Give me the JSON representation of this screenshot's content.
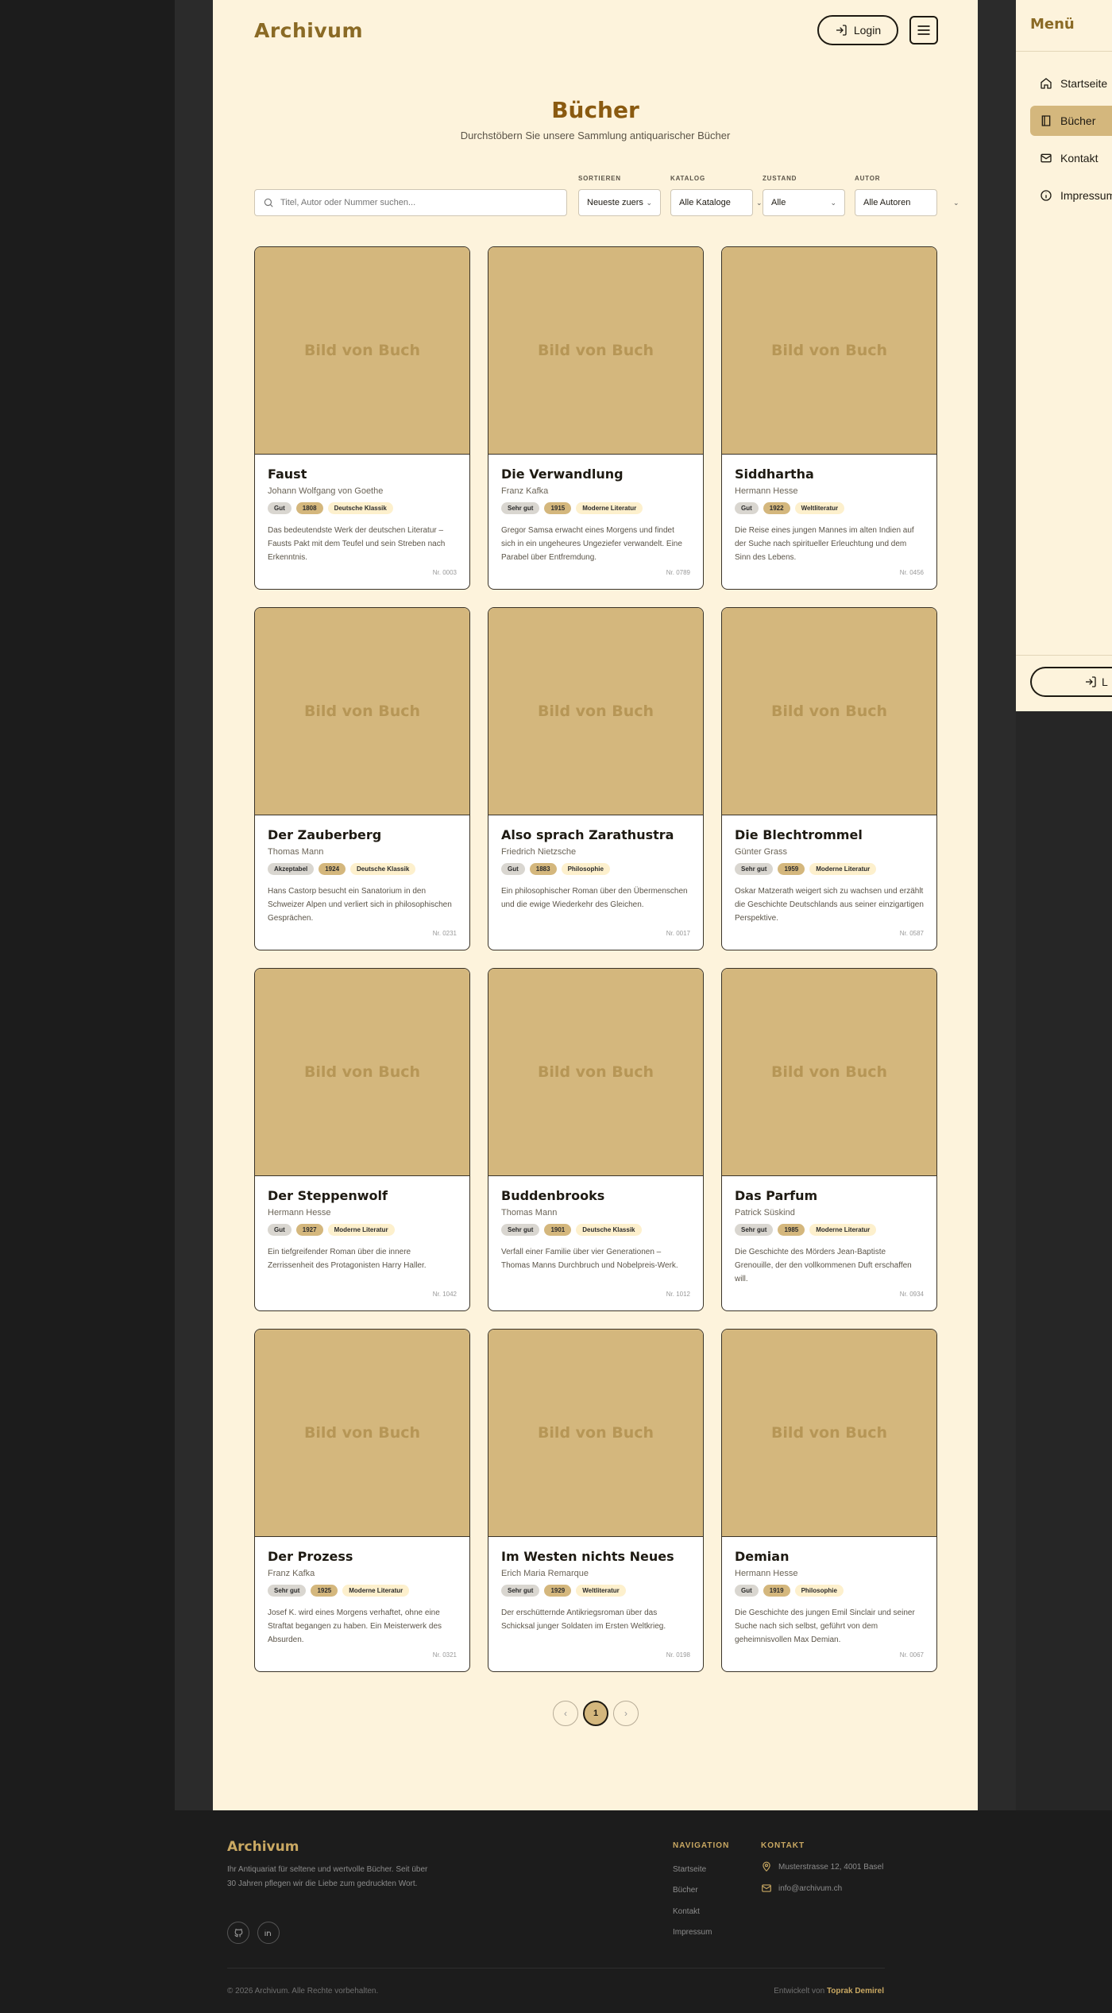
{
  "header": {
    "logo": "Archivum",
    "login_label": "Login"
  },
  "page": {
    "title": "Bücher",
    "subtitle": "Durchstöbern Sie unsere Sammlung antiquarischer Bücher"
  },
  "filters": {
    "search_placeholder": "Titel, Autor oder Nummer suchen...",
    "sort": {
      "label": "SORTIEREN",
      "value": "Neueste zuers"
    },
    "catalog": {
      "label": "KATALOG",
      "value": "Alle Kataloge"
    },
    "condition": {
      "label": "ZUSTAND",
      "value": "Alle"
    },
    "author": {
      "label": "AUTOR",
      "value": "Alle Autoren"
    }
  },
  "image_placeholder": "Bild von Buch",
  "books": [
    {
      "title": "Faust",
      "author": "Johann Wolfgang von Goethe",
      "condition": "Gut",
      "year": "1808",
      "category": "Deutsche Klassik",
      "description": "Das bedeutendste Werk der deutschen Literatur – Fausts Pakt mit dem Teufel und sein Streben nach Erkenntnis.",
      "nr": "Nr. 0003"
    },
    {
      "title": "Die Verwandlung",
      "author": "Franz Kafka",
      "condition": "Sehr gut",
      "year": "1915",
      "category": "Moderne Literatur",
      "description": "Gregor Samsa erwacht eines Morgens und findet sich in ein ungeheures Ungeziefer verwandelt. Eine Parabel über Entfremdung.",
      "nr": "Nr. 0789"
    },
    {
      "title": "Siddhartha",
      "author": "Hermann Hesse",
      "condition": "Gut",
      "year": "1922",
      "category": "Weltliteratur",
      "description": "Die Reise eines jungen Mannes im alten Indien auf der Suche nach spiritueller Erleuchtung und dem Sinn des Lebens.",
      "nr": "Nr. 0456"
    },
    {
      "title": "Der Zauberberg",
      "author": "Thomas Mann",
      "condition": "Akzeptabel",
      "year": "1924",
      "category": "Deutsche Klassik",
      "description": "Hans Castorp besucht ein Sanatorium in den Schweizer Alpen und verliert sich in philosophischen Gesprächen.",
      "nr": "Nr. 0231"
    },
    {
      "title": "Also sprach Zarathustra",
      "author": "Friedrich Nietzsche",
      "condition": "Gut",
      "year": "1883",
      "category": "Philosophie",
      "description": "Ein philosophischer Roman über den Übermenschen und die ewige Wiederkehr des Gleichen.",
      "nr": "Nr. 0017"
    },
    {
      "title": "Die Blechtrommel",
      "author": "Günter Grass",
      "condition": "Sehr gut",
      "year": "1959",
      "category": "Moderne Literatur",
      "description": "Oskar Matzerath weigert sich zu wachsen und erzählt die Geschichte Deutschlands aus seiner einzigartigen Perspektive.",
      "nr": "Nr. 0587"
    },
    {
      "title": "Der Steppenwolf",
      "author": "Hermann Hesse",
      "condition": "Gut",
      "year": "1927",
      "category": "Moderne Literatur",
      "description": "Ein tiefgreifender Roman über die innere Zerrissenheit des Protagonisten Harry Haller.",
      "nr": "Nr. 1042"
    },
    {
      "title": "Buddenbrooks",
      "author": "Thomas Mann",
      "condition": "Sehr gut",
      "year": "1901",
      "category": "Deutsche Klassik",
      "description": "Verfall einer Familie über vier Generationen – Thomas Manns Durchbruch und Nobelpreis-Werk.",
      "nr": "Nr. 1012"
    },
    {
      "title": "Das Parfum",
      "author": "Patrick Süskind",
      "condition": "Sehr gut",
      "year": "1985",
      "category": "Moderne Literatur",
      "description": "Die Geschichte des Mörders Jean-Baptiste Grenouille, der den vollkommenen Duft erschaffen will.",
      "nr": "Nr. 0934"
    },
    {
      "title": "Der Prozess",
      "author": "Franz Kafka",
      "condition": "Sehr gut",
      "year": "1925",
      "category": "Moderne Literatur",
      "description": "Josef K. wird eines Morgens verhaftet, ohne eine Straftat begangen zu haben. Ein Meisterwerk des Absurden.",
      "nr": "Nr. 0321"
    },
    {
      "title": "Im Westen nichts Neues",
      "author": "Erich Maria Remarque",
      "condition": "Sehr gut",
      "year": "1929",
      "category": "Weltliteratur",
      "description": "Der erschütternde Antikriegsroman über das Schicksal junger Soldaten im Ersten Weltkrieg.",
      "nr": "Nr. 0198"
    },
    {
      "title": "Demian",
      "author": "Hermann Hesse",
      "condition": "Gut",
      "year": "1919",
      "category": "Philosophie",
      "description": "Die Geschichte des jungen Emil Sinclair und seiner Suche nach sich selbst, geführt von dem geheimnisvollen Max Demian.",
      "nr": "Nr. 0067"
    }
  ],
  "pagination": {
    "prev": "‹",
    "current": "1",
    "next": "›"
  },
  "side_menu": {
    "title": "Menü",
    "items": [
      {
        "label": "Startseite",
        "icon": "home-icon"
      },
      {
        "label": "Bücher",
        "icon": "book-icon"
      },
      {
        "label": "Kontakt",
        "icon": "mail-icon"
      },
      {
        "label": "Impressum",
        "icon": "info-icon"
      }
    ],
    "login_label": "L"
  },
  "footer": {
    "logo": "Archivum",
    "description": "Ihr Antiquariat für seltene und wertvolle Bücher. Seit über 30 Jahren pflegen wir die Liebe zum gedruckten Wort.",
    "nav_heading": "NAVIGATION",
    "nav": [
      "Startseite",
      "Bücher",
      "Kontakt",
      "Impressum"
    ],
    "contact_heading": "KONTAKT",
    "address": "Musterstrasse 12, 4001 Basel",
    "email": "info@archivum.ch",
    "copyright": "© 2026 Archivum. Alle Rechte vorbehalten.",
    "developed_prefix": "Entwickelt von",
    "developer": "Toprak Demirel"
  },
  "colors": {
    "accent": "#8a6a25",
    "cover": "#d4b77d",
    "background": "#fdf3dc",
    "footer": "#1c1c1c"
  }
}
